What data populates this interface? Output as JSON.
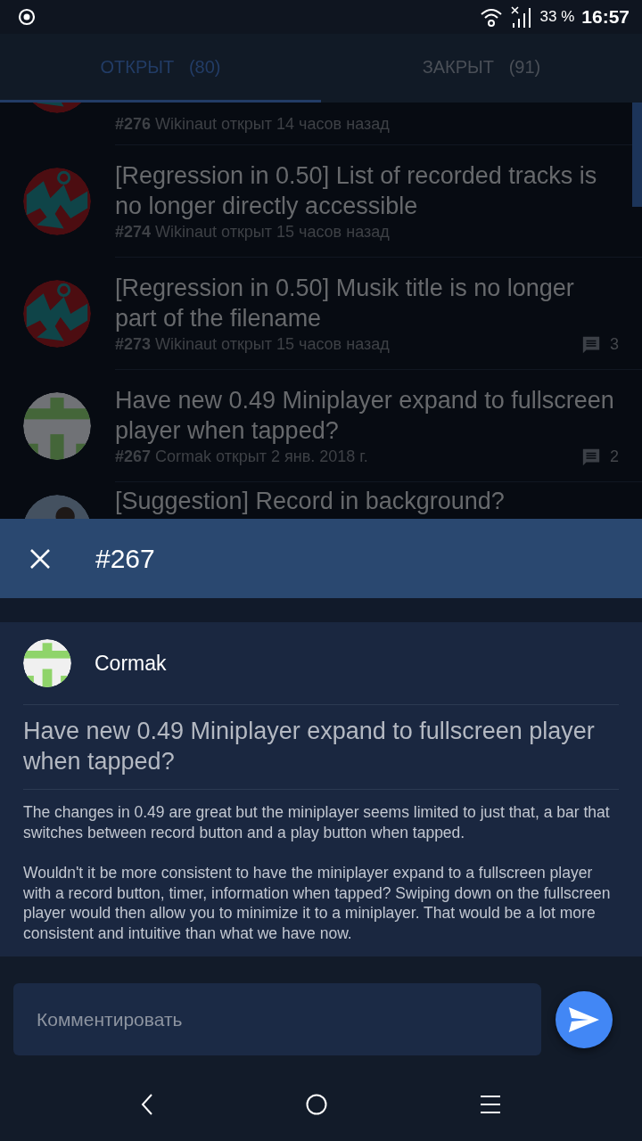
{
  "status_bar": {
    "battery": "33 %",
    "time": "16:57"
  },
  "tabs": [
    {
      "label": "ОТКРЫТ",
      "count": "(80)",
      "selected": true
    },
    {
      "label": "ЗАКРЫТ",
      "count": "(91)",
      "selected": false
    }
  ],
  "issues": [
    {
      "kind": "cut-top",
      "number": "#276",
      "meta": "Wikinaut открыт 14 часов назад",
      "avatar": {
        "kind": "red"
      }
    },
    {
      "kind": "full",
      "title": "[Regression in 0.50] List of recorded tracks is no longer directly accessible",
      "number": "#274",
      "meta": "Wikinaut открыт 15 часов назад",
      "avatar": {
        "kind": "red"
      }
    },
    {
      "kind": "full",
      "title": "[Regression in 0.50] Musik title is no longer part of the filename",
      "number": "#273",
      "meta": "Wikinaut открыт 15 часов назад",
      "avatar": {
        "kind": "red"
      },
      "comments": "3"
    },
    {
      "kind": "full",
      "title": "Have new 0.49 Miniplayer expand to fullscreen player when tapped?",
      "number": "#267",
      "meta": "Cormak открыт 2 янв. 2018 г.",
      "avatar": {
        "kind": "green"
      },
      "comments": "2"
    },
    {
      "kind": "cut-bottom",
      "title": "[Suggestion] Record in background?",
      "avatar": {
        "kind": "photo"
      }
    }
  ],
  "sheet": {
    "title": "#267",
    "author": "Cormak",
    "avatar": {
      "kind": "green"
    },
    "issue_title": "Have new 0.49 Miniplayer expand to fullscreen player when tapped?",
    "body": [
      "The changes in 0.49 are great but the miniplayer seems limited to just that, a bar that switches between record button and a play button when tapped.",
      "Wouldn't it be more consistent to have the miniplayer expand to a fullscreen player with a record button, timer, information when tapped? Swiping down on the fullscreen player would then allow you to minimize it to a miniplayer. That would be a lot more consistent and intuitive than what we have now."
    ]
  },
  "comment_field": {
    "placeholder": "Комментировать"
  }
}
